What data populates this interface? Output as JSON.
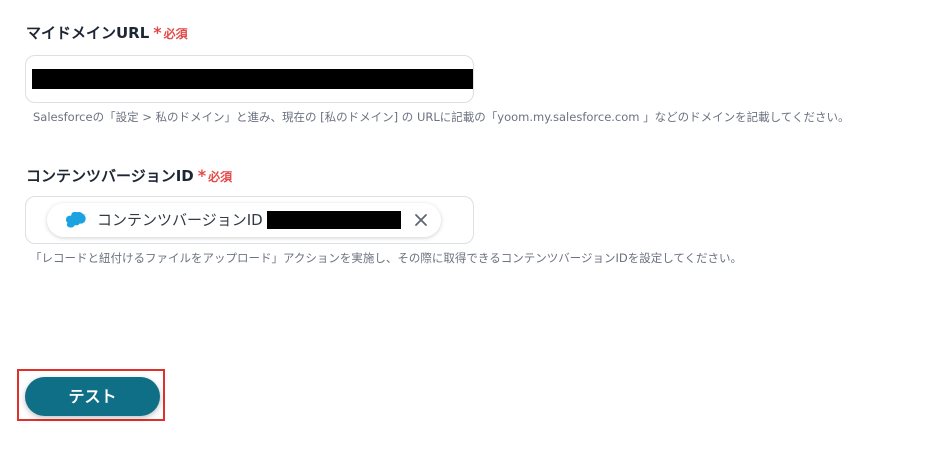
{
  "domain_field": {
    "label": "マイドメインURL",
    "required_mark": "*",
    "required_text": "必須",
    "help": "Salesforceの「設定 > 私のドメイン」と進み、現在の [私のドメイン] の URLに記載の「yoom.my.salesforce.com 」などのドメインを記載してください。"
  },
  "version_field": {
    "label": "コンテンツバージョンID",
    "required_mark": "*",
    "required_text": "必須",
    "chip_text": "コンテンツバージョンID",
    "chip_icon": "salesforce-cloud-icon",
    "help": "「レコードと紐付けるファイルをアップロード」アクションを実施し、その際に取得できるコンテンツバージョンIDを設定してください。"
  },
  "actions": {
    "test_label": "テスト"
  },
  "colors": {
    "required": "#e34b4b",
    "button": "#0f6f86",
    "highlight": "#e0302a",
    "salesforce": "#1ba2e0"
  }
}
